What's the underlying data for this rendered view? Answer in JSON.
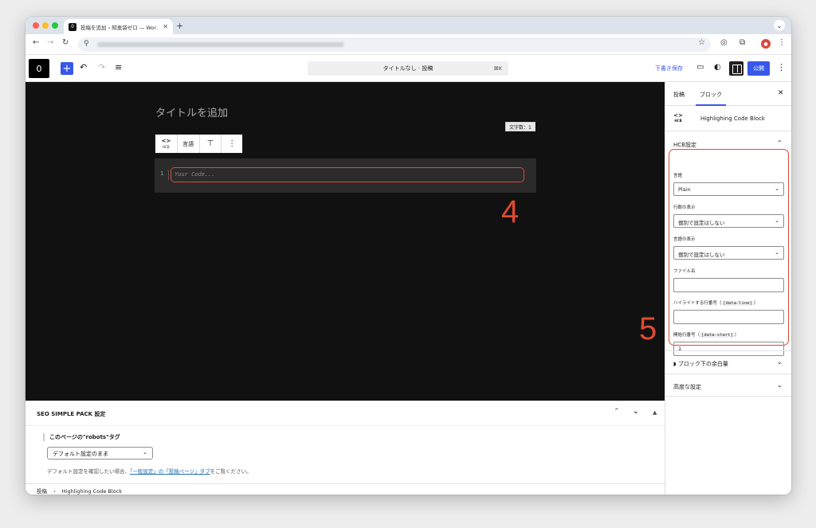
{
  "browser": {
    "tab_title": "投稿を追加 ‹ 知恵袋ゼロ — Wor…",
    "tab_favicon": "0",
    "new_tab": "+",
    "traffic_lights": [
      "#ff5f57",
      "#febc2e",
      "#28c840"
    ]
  },
  "toolbar": {
    "logo": "0",
    "add": "+",
    "command_title": "タイトルなし · 投稿",
    "command_shortcut": "⌘K",
    "save_draft": "下書き保存",
    "publish": "公開"
  },
  "editor": {
    "title_placeholder": "タイトルを追加",
    "block_toolbar": {
      "hcb_icon": "<>",
      "hcb_sub": "HCB",
      "language_button": "言語"
    },
    "word_count": "文字数：1",
    "code": {
      "line_number": "1",
      "placeholder": "Your Code..."
    }
  },
  "annotations": {
    "code_marker": "4",
    "sidebar_marker": "5",
    "color": "#e04a2f"
  },
  "seo": {
    "title": "SEO SIMPLE PACK 設定",
    "robots_label": "このページの\"robots\"タグ",
    "robots_value": "デフォルト設定のまま",
    "note_prefix": "デフォルト設定を確認したい場合、",
    "note_link": "「一般設定」の「投稿ページ」タブ",
    "note_suffix": "をご覧ください。"
  },
  "statusbar": {
    "crumb_1": "投稿",
    "separator": "›",
    "crumb_2": "Highlighing Code Block"
  },
  "sidebar": {
    "tab_post": "投稿",
    "tab_block": "ブロック",
    "block_name": "Highlighing Code Block",
    "block_icon_top": "<>",
    "block_icon_sub": "HCB",
    "section_title": "HCB設定",
    "fields": {
      "language_label": "言語",
      "language_value": "Plain",
      "line_numbers_label": "行数の表示",
      "line_numbers_value": "個別で設定はしない",
      "lang_display_label": "言語の表示",
      "lang_display_value": "個別で設定はしない",
      "filename_label": "ファイル名",
      "filename_value": "",
      "highlight_label_prefix": "ハイライトする行番号（",
      "highlight_code": "[data-line]",
      "highlight_label_suffix": "）",
      "highlight_value": "",
      "start_label_prefix": "開始行番号（",
      "start_code": "[data-start]",
      "start_label_suffix": "）",
      "start_value": "1"
    },
    "panel_margin": "ブロック下の余白量",
    "panel_advanced": "高度な設定"
  }
}
